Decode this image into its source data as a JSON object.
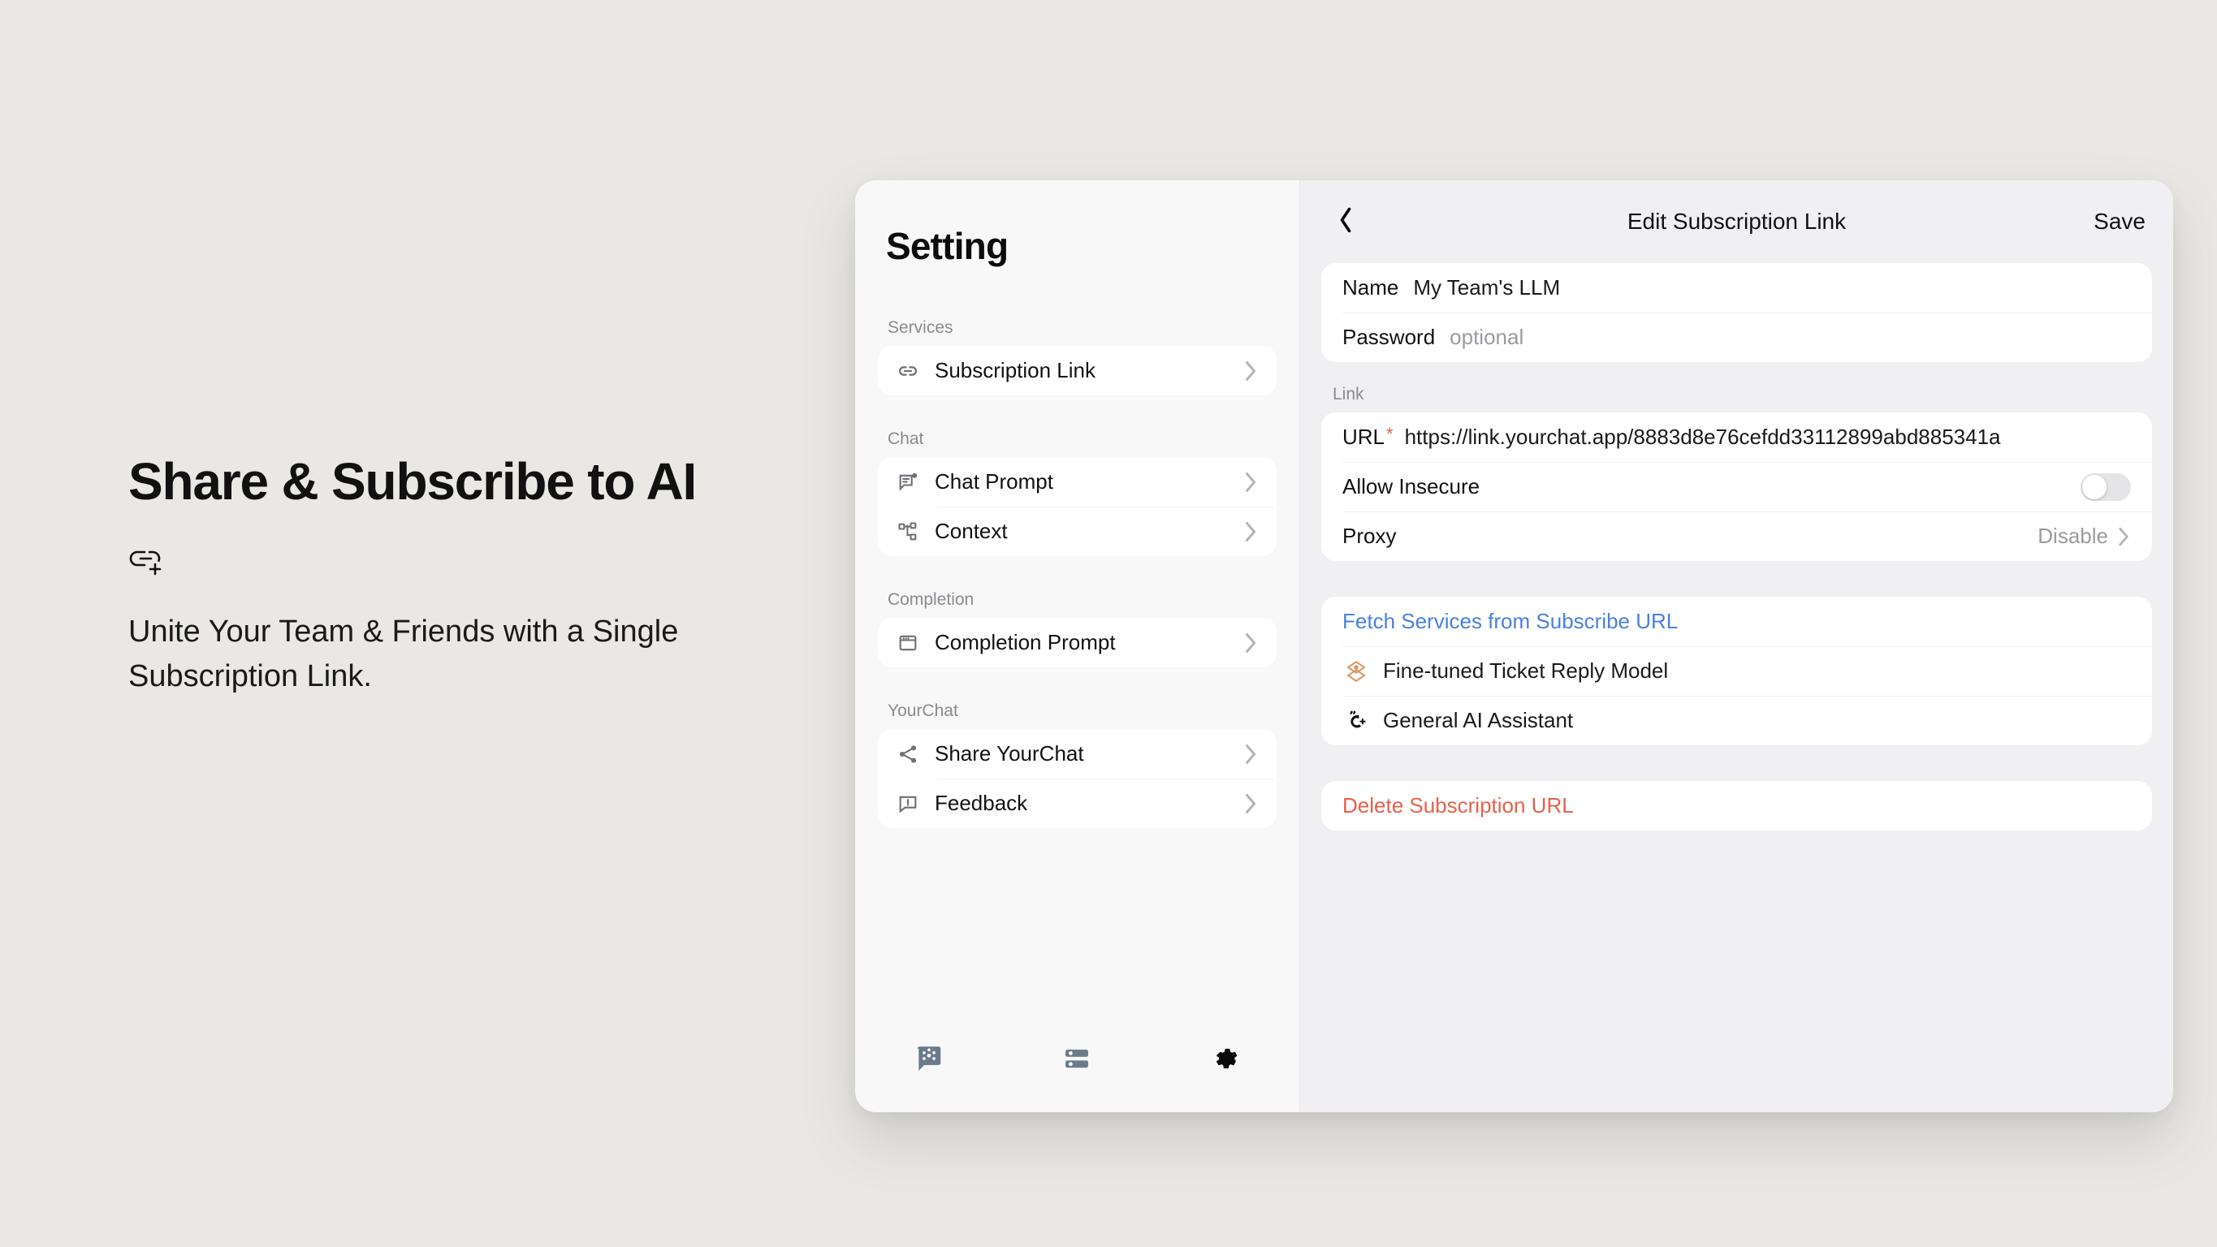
{
  "promo": {
    "title": "Share & Subscribe to AI",
    "icon": "link-add-icon",
    "subtitle": "Unite Your Team & Friends with a Single Subscription Link."
  },
  "sidebar": {
    "title": "Setting",
    "groups": [
      {
        "label": "Services",
        "items": [
          {
            "label": "Subscription Link",
            "icon": "link-icon",
            "chevron": "›"
          }
        ]
      },
      {
        "label": "Chat",
        "items": [
          {
            "label": "Chat Prompt",
            "icon": "chat-prompt-icon",
            "chevron": "›"
          },
          {
            "label": "Context",
            "icon": "context-tree-icon",
            "chevron": "›"
          }
        ]
      },
      {
        "label": "Completion",
        "items": [
          {
            "label": "Completion Prompt",
            "icon": "completion-window-icon",
            "chevron": "›"
          }
        ]
      },
      {
        "label": "YourChat",
        "items": [
          {
            "label": "Share YourChat",
            "icon": "share-icon",
            "chevron": "›"
          },
          {
            "label": "Feedback",
            "icon": "feedback-icon",
            "chevron": "›"
          }
        ]
      }
    ],
    "tabs": [
      {
        "name": "chat-tab",
        "icon": "chat-nodes-icon",
        "active": false
      },
      {
        "name": "services-tab",
        "icon": "server-stack-icon",
        "active": false
      },
      {
        "name": "settings-tab",
        "icon": "gear-icon",
        "active": true
      }
    ]
  },
  "detail": {
    "back_icon": "chevron-left-icon",
    "title": "Edit Subscription Link",
    "save_label": "Save",
    "basic_fields": [
      {
        "label": "Name",
        "value": "My Team's LLM",
        "is_placeholder": false
      },
      {
        "label": "Password",
        "value": "optional",
        "is_placeholder": true
      }
    ],
    "link_section": {
      "label": "Link",
      "url_label": "URL",
      "url_required_mark": "*",
      "url_value": "https://link.yourchat.app/8883d8e76cefdd33112899abd885341a",
      "allow_insecure_label": "Allow Insecure",
      "allow_insecure_on": false,
      "proxy_label": "Proxy",
      "proxy_value": "Disable",
      "proxy_chevron": "›"
    },
    "services_section": {
      "fetch_label": "Fetch Services from Subscribe URL",
      "items": [
        {
          "label": "Fine-tuned Ticket Reply Model",
          "icon": "layers-diamond-icon"
        },
        {
          "label": "General AI Assistant",
          "icon": "cpp-assistant-icon"
        }
      ]
    },
    "delete_label": "Delete Subscription URL"
  },
  "colors": {
    "page_background": "#e9e8e5",
    "sidebar_background": "#f8f8f8",
    "detail_background": "#f0f0f3",
    "card_background": "#ffffff",
    "accent_link": "#4b80e0",
    "danger": "#e8604c",
    "required_mark": "#e8604c",
    "muted_text": "#8b8b90",
    "service_icon_orange": "#d89a63"
  }
}
